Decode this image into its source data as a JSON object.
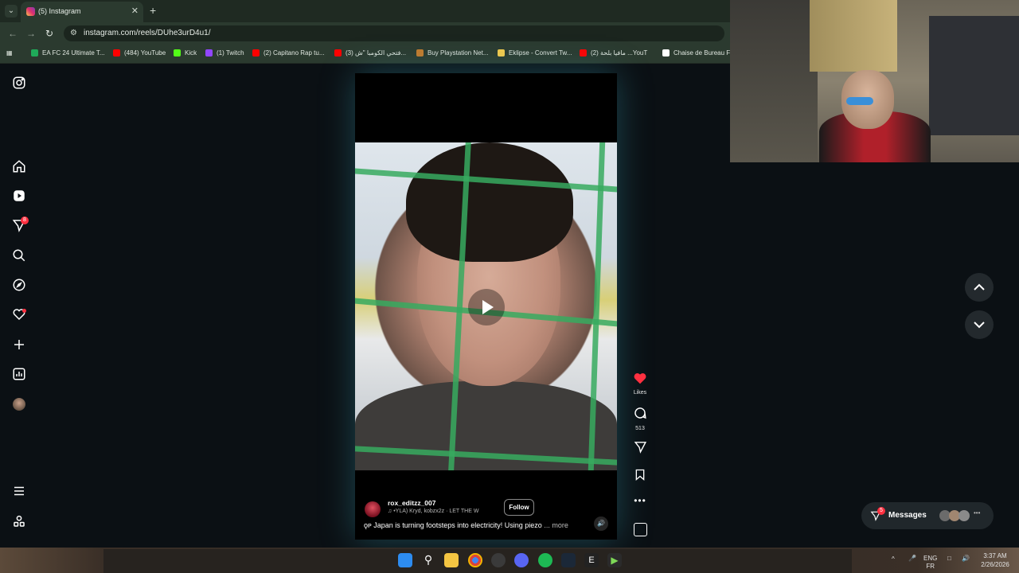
{
  "browser": {
    "tab_title": "(5) Instagram",
    "new_tab_label": "+",
    "url": "instagram.com/reels/DUhe3urD4u1/",
    "bookmarks": [
      {
        "label": "EA FC 24 Ultimate T...",
        "color": "#1faa59"
      },
      {
        "label": "(484) YouTube",
        "color": "#ff0000"
      },
      {
        "label": "Kick",
        "color": "#53fc18"
      },
      {
        "label": "(1) Twitch",
        "color": "#9146ff"
      },
      {
        "label": "(2) Capitano Rap tu...",
        "color": "#ff0000"
      },
      {
        "label": "(3) فتحي الكومبا \"ش...",
        "color": "#ff0000"
      },
      {
        "label": "Buy Playstation Net...",
        "color": "#c27a2c"
      },
      {
        "label": "Eklipse - Convert Tw...",
        "color": "#f2c94c"
      },
      {
        "label": "(2) مافيا بلحة ...YouT",
        "color": "#ff0000"
      },
      {
        "label": "Chaise de Bureau F...",
        "color": "#ffffff"
      }
    ]
  },
  "sidebar": {
    "notifications_badge": "8"
  },
  "reel": {
    "author": "rox_editzz_007",
    "music": "•YLA)  Kryd, kobzx2z · LET THE W",
    "follow_label": "Follow",
    "caption": "̱ıг Japan is turning footsteps into electricity! Using piezo",
    "caption_display": "ǫᴘ Japan is turning footsteps into electricity! Using piezo",
    "more_label": "... more",
    "likes_label": "Likes",
    "comments_count": "513"
  },
  "messages": {
    "label": "Messages",
    "badge": "5"
  },
  "taskbar": {
    "lang_top": "ENG",
    "lang_bottom": "FR",
    "time": "3:37 AM",
    "date": "2/26/2026"
  }
}
